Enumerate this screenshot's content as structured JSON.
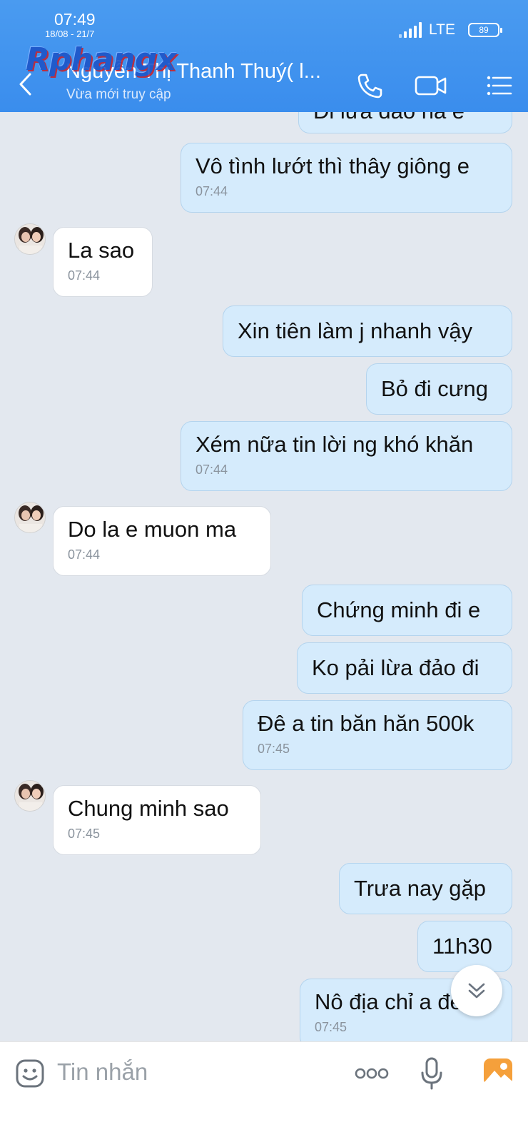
{
  "status_bar": {
    "time": "07:49",
    "date": "18/08 - 21/7",
    "network": "LTE",
    "battery": "89"
  },
  "watermark": "Rphangx",
  "header": {
    "title": "Nguyễn Thị Thanh Thuý( l...",
    "subtitle": "Vừa mới truy cập",
    "back_icon": "chevron-left-icon",
    "call_icon": "phone-icon",
    "video_icon": "video-camera-icon",
    "menu_icon": "list-menu-icon"
  },
  "messages": [
    {
      "dir": "out",
      "text": "Đi lừa đảo hả e",
      "time": ""
    },
    {
      "dir": "out",
      "text": "Vô tình lướt thì thây giông e",
      "time": "07:44"
    },
    {
      "dir": "in",
      "text": "La sao",
      "time": "07:44"
    },
    {
      "dir": "out",
      "text": "Xin tiên làm j nhanh vậy",
      "time": ""
    },
    {
      "dir": "out",
      "text": "Bỏ đi cưng",
      "time": ""
    },
    {
      "dir": "out",
      "text": "Xém nữa tin lời ng khó khăn",
      "time": "07:44"
    },
    {
      "dir": "in",
      "text": "Do la e muon ma",
      "time": "07:44"
    },
    {
      "dir": "out",
      "text": "Chứng minh đi e",
      "time": ""
    },
    {
      "dir": "out",
      "text": "Ko pải lừa đảo đi",
      "time": ""
    },
    {
      "dir": "out",
      "text": "Đê a tin băn hăn 500k",
      "time": "07:45"
    },
    {
      "dir": "in",
      "text": "Chung minh sao",
      "time": "07:45"
    },
    {
      "dir": "out",
      "text": "Trưa nay gặp",
      "time": ""
    },
    {
      "dir": "out",
      "text": "11h30",
      "time": ""
    },
    {
      "dir": "out",
      "text": "Nô địa chỉ a đến",
      "time": "07:45"
    }
  ],
  "input_bar": {
    "placeholder": "Tin nhắn",
    "emoji_icon": "emoji-icon",
    "more_icon": "more-dots-icon",
    "mic_icon": "microphone-icon",
    "gallery_icon": "image-gallery-icon"
  },
  "colors": {
    "header": "#3a8ded",
    "outgoing_bubble": "#d5ebfc",
    "incoming_bubble": "#ffffff",
    "chat_background": "#e3e8ef",
    "gallery_icon": "#f5a03b"
  }
}
